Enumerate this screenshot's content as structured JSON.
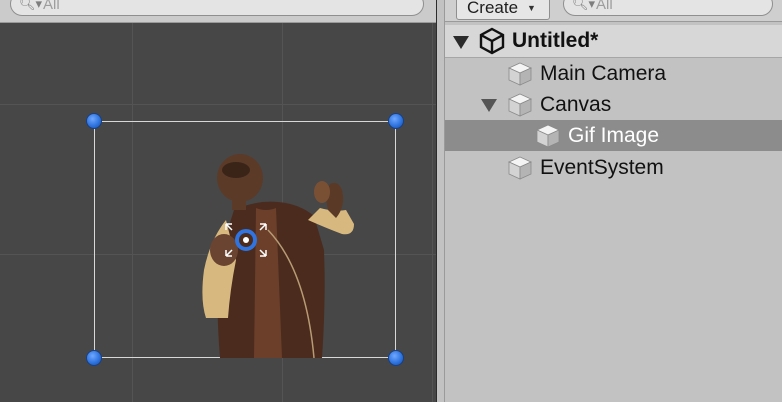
{
  "scene": {
    "search_placeholder": "All",
    "search_icon": "search-dropdown-icon"
  },
  "hierarchy": {
    "create_label": "Create",
    "create_icon": "dropdown-arrow-icon",
    "search_placeholder": "All",
    "scene_name": "Untitled*",
    "items": [
      {
        "label": "Main Camera",
        "icon": "gameobject-cube-icon"
      },
      {
        "label": "Canvas",
        "icon": "gameobject-cube-icon",
        "expanded": true
      },
      {
        "label": "Gif Image",
        "icon": "gameobject-cube-icon",
        "selected": true
      },
      {
        "label": "EventSystem",
        "icon": "gameobject-cube-icon"
      }
    ]
  },
  "colors": {
    "scene_background": "#474747",
    "panel_background": "#c2c2c2",
    "selection": "#8c8c8c",
    "handle_blue": "#2f74e0"
  }
}
